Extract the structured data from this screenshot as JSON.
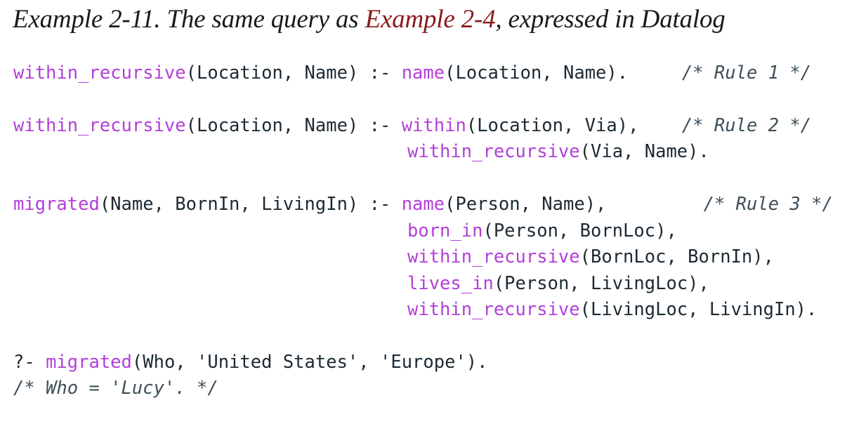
{
  "caption": {
    "prefix": "Example 2-11. The same query as ",
    "link": "Example 2-4",
    "suffix": ", expressed in Datalog"
  },
  "code": {
    "rule1": {
      "head_fn": "within_recursive",
      "head_args": "(Location, Name) :- ",
      "body_fn": "name",
      "body_args": "(Location, Name).     ",
      "comment": "/* Rule 1 */"
    },
    "rule2": {
      "head_fn": "within_recursive",
      "head_args": "(Location, Name) :- ",
      "body1_fn": "within",
      "body1_args": "(Location, Via),    ",
      "comment": "/* Rule 2 */",
      "body2_fn": "within_recursive",
      "body2_args": "(Via, Name)."
    },
    "rule3": {
      "head_fn": "migrated",
      "head_args": "(Name, BornIn, LivingIn) :- ",
      "body1_fn": "name",
      "body1_args": "(Person, Name),         ",
      "comment": "/* Rule 3 */",
      "body2_fn": "born_in",
      "body2_args": "(Person, BornLoc),",
      "body3_fn": "within_recursive",
      "body3_args": "(BornLoc, BornIn),",
      "body4_fn": "lives_in",
      "body4_args": "(Person, LivingLoc),",
      "body5_fn": "within_recursive",
      "body5_args": "(LivingLoc, LivingIn)."
    },
    "query": {
      "prompt": "?- ",
      "fn": "migrated",
      "args": "(Who, 'United States', 'Europe').",
      "result_comment": "/* Who = 'Lucy'. */"
    }
  }
}
